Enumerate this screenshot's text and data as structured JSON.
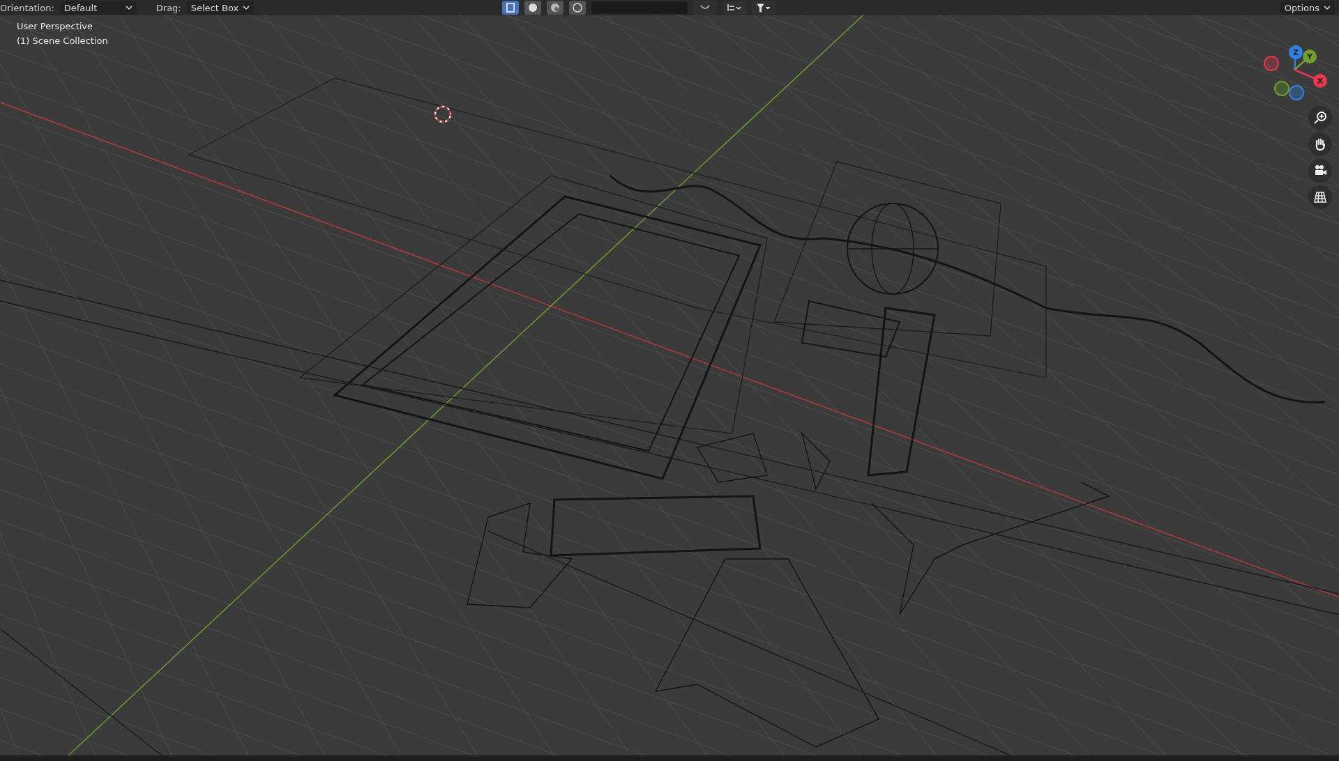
{
  "header": {
    "orientation_label": "Orientation:",
    "orientation_value": "Default",
    "drag_label": "Drag:",
    "drag_value": "Select Box",
    "shading_modes": [
      {
        "kind": "wireframe",
        "selected": true
      },
      {
        "kind": "solid",
        "selected": false
      },
      {
        "kind": "material",
        "selected": false
      },
      {
        "kind": "rendered",
        "selected": false
      }
    ],
    "options": "Options"
  },
  "viewport": {
    "view_name": "User Perspective",
    "collection": "(1) Scene Collection"
  },
  "gizmo": {
    "axes": [
      {
        "label": "Z",
        "color": "#2f83e6"
      },
      {
        "label": "Y",
        "color": "#6ea02b"
      },
      {
        "label": "X",
        "color": "#e6384f"
      }
    ]
  }
}
